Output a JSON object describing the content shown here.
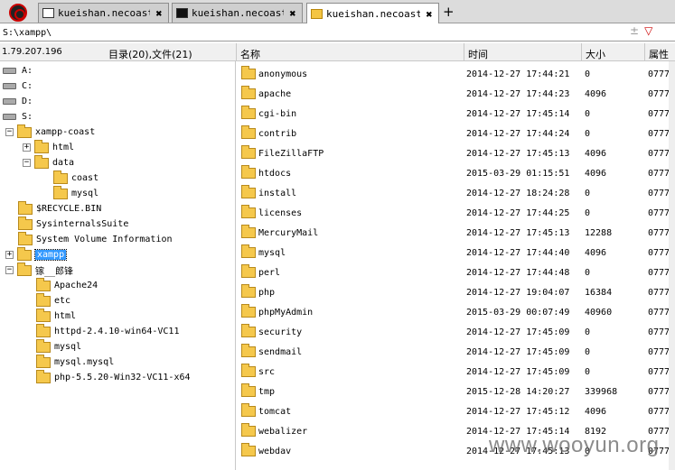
{
  "tabs": [
    {
      "label": "kueishan.necoast-...",
      "icon": "window-icon",
      "close": "✖"
    },
    {
      "label": "kueishan.necoast-...",
      "icon": "terminal-icon",
      "close": "✖"
    },
    {
      "label": "kueishan.necoast-...",
      "icon": "folder-icon",
      "close": "✖"
    }
  ],
  "new_tab_label": "+",
  "address": {
    "path": "S:\\xampp\\",
    "pin_icon": "±",
    "dropdown_icon": "▽"
  },
  "header": {
    "ip": "1.79.207.196",
    "count": "目录(20),文件(21)",
    "columns": {
      "name": "名称",
      "time": "时间",
      "size": "大小",
      "attr": "属性"
    }
  },
  "tree": [
    {
      "label": "A:",
      "type": "drive"
    },
    {
      "label": "C:",
      "type": "drive"
    },
    {
      "label": "D:",
      "type": "drive"
    },
    {
      "label": "S:",
      "type": "drive"
    },
    {
      "label": "xampp-coast",
      "type": "folder",
      "expander": "−"
    },
    {
      "label": "html",
      "type": "folder",
      "expander": "+"
    },
    {
      "label": "data",
      "type": "folder",
      "expander": "−"
    },
    {
      "label": "coast",
      "type": "folder"
    },
    {
      "label": "mysql",
      "type": "folder"
    },
    {
      "label": "$RECYCLE.BIN",
      "type": "folder"
    },
    {
      "label": "SysinternalsSuite",
      "type": "folder"
    },
    {
      "label": "System Volume Information",
      "type": "folder"
    },
    {
      "label": "xampp",
      "type": "folder",
      "expander": "+",
      "selected": true
    },
    {
      "label": "镓__郎锋",
      "type": "folder",
      "expander": "−"
    },
    {
      "label": "Apache24",
      "type": "folder"
    },
    {
      "label": "etc",
      "type": "folder"
    },
    {
      "label": "html",
      "type": "folder"
    },
    {
      "label": "httpd-2.4.10-win64-VC11",
      "type": "folder"
    },
    {
      "label": "mysql",
      "type": "folder"
    },
    {
      "label": "mysql.mysql",
      "type": "folder"
    },
    {
      "label": "php-5.5.20-Win32-VC11-x64",
      "type": "folder"
    }
  ],
  "files": [
    {
      "name": "anonymous",
      "time": "2014-12-27 17:44:21",
      "size": "0",
      "attr": "0777"
    },
    {
      "name": "apache",
      "time": "2014-12-27 17:44:23",
      "size": "4096",
      "attr": "0777"
    },
    {
      "name": "cgi-bin",
      "time": "2014-12-27 17:45:14",
      "size": "0",
      "attr": "0777"
    },
    {
      "name": "contrib",
      "time": "2014-12-27 17:44:24",
      "size": "0",
      "attr": "0777"
    },
    {
      "name": "FileZillaFTP",
      "time": "2014-12-27 17:45:13",
      "size": "4096",
      "attr": "0777"
    },
    {
      "name": "htdocs",
      "time": "2015-03-29 01:15:51",
      "size": "4096",
      "attr": "0777"
    },
    {
      "name": "install",
      "time": "2014-12-27 18:24:28",
      "size": "0",
      "attr": "0777"
    },
    {
      "name": "licenses",
      "time": "2014-12-27 17:44:25",
      "size": "0",
      "attr": "0777"
    },
    {
      "name": "MercuryMail",
      "time": "2014-12-27 17:45:13",
      "size": "12288",
      "attr": "0777"
    },
    {
      "name": "mysql",
      "time": "2014-12-27 17:44:40",
      "size": "4096",
      "attr": "0777"
    },
    {
      "name": "perl",
      "time": "2014-12-27 17:44:48",
      "size": "0",
      "attr": "0777"
    },
    {
      "name": "php",
      "time": "2014-12-27 19:04:07",
      "size": "16384",
      "attr": "0777"
    },
    {
      "name": "phpMyAdmin",
      "time": "2015-03-29 00:07:49",
      "size": "40960",
      "attr": "0777"
    },
    {
      "name": "security",
      "time": "2014-12-27 17:45:09",
      "size": "0",
      "attr": "0777"
    },
    {
      "name": "sendmail",
      "time": "2014-12-27 17:45:09",
      "size": "0",
      "attr": "0777"
    },
    {
      "name": "src",
      "time": "2014-12-27 17:45:09",
      "size": "0",
      "attr": "0777"
    },
    {
      "name": "tmp",
      "time": "2015-12-28 14:20:27",
      "size": "339968",
      "attr": "0777"
    },
    {
      "name": "tomcat",
      "time": "2014-12-27 17:45:12",
      "size": "4096",
      "attr": "0777"
    },
    {
      "name": "webalizer",
      "time": "2014-12-27 17:45:14",
      "size": "8192",
      "attr": "0777"
    },
    {
      "name": "webdav",
      "time": "2014-12-27 17:45:13",
      "size": "0",
      "attr": "0777"
    }
  ],
  "watermark": "www.wooyun.org"
}
